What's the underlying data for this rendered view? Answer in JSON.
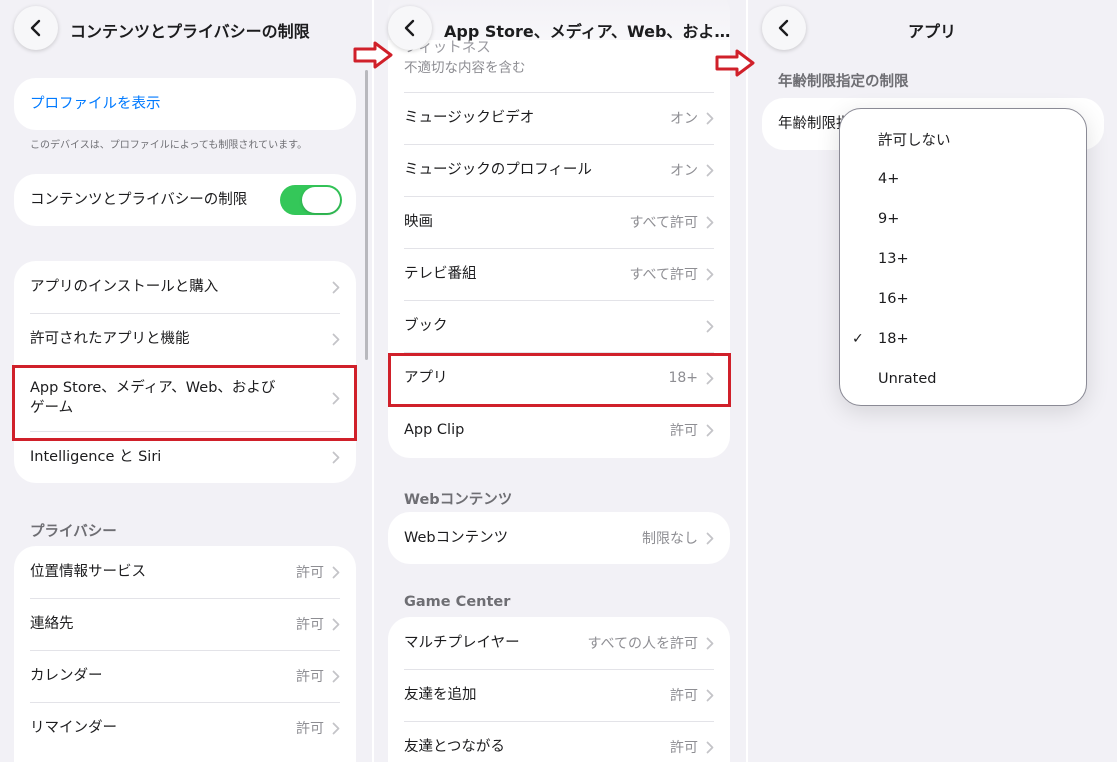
{
  "panel1": {
    "title": "コンテンツとプライバシーの制限",
    "profile_link": "プロファイルを表示",
    "profile_note": "このデバイスは、プロファイルによっても制限されています。",
    "toggle_label": "コンテンツとプライバシーの制限",
    "toggle_on": true,
    "group1": [
      {
        "label": "アプリのインストールと購入"
      },
      {
        "label": "許可されたアプリと機能"
      },
      {
        "label": "App Store、メディア、Web、および\nゲーム"
      },
      {
        "label": "Intelligence と Siri"
      }
    ],
    "privacy_header": "プライバシー",
    "privacy": [
      {
        "label": "位置情報サービス",
        "value": "許可"
      },
      {
        "label": "連絡先",
        "value": "許可"
      },
      {
        "label": "カレンダー",
        "value": "許可"
      },
      {
        "label": "リマインダー",
        "value": "許可"
      }
    ]
  },
  "panel2": {
    "title": "App Store、メディア、Web、およ…",
    "partial_label": "フィットネス",
    "partial_sub": "不適切な内容を含む",
    "group1": [
      {
        "label": "ミュージックビデオ",
        "value": "オン"
      },
      {
        "label": "ミュージックのプロフィール",
        "value": "オン"
      },
      {
        "label": "映画",
        "value": "すべて許可"
      },
      {
        "label": "テレビ番組",
        "value": "すべて許可"
      },
      {
        "label": "ブック",
        "value": ""
      },
      {
        "label": "アプリ",
        "value": "18+"
      },
      {
        "label": "App Clip",
        "value": "許可"
      }
    ],
    "web_header": "Webコンテンツ",
    "web": [
      {
        "label": "Webコンテンツ",
        "value": "制限なし"
      }
    ],
    "gc_header": "Game Center",
    "gc": [
      {
        "label": "マルチプレイヤー",
        "value": "すべての人を許可"
      },
      {
        "label": "友達を追加",
        "value": "許可"
      },
      {
        "label": "友達とつながる",
        "value": "許可"
      }
    ]
  },
  "panel3": {
    "title": "アプリ",
    "section_header": "年齢制限指定の制限",
    "row_label": "年齢制限指",
    "options": [
      "許可しない",
      "4+",
      "9+",
      "13+",
      "16+",
      "18+",
      "Unrated"
    ],
    "selected_index": 5,
    "check_mark": "✓"
  },
  "colors": {
    "accent": "#007aff",
    "toggle_green": "#34c759",
    "highlight_red": "#d0202a"
  }
}
